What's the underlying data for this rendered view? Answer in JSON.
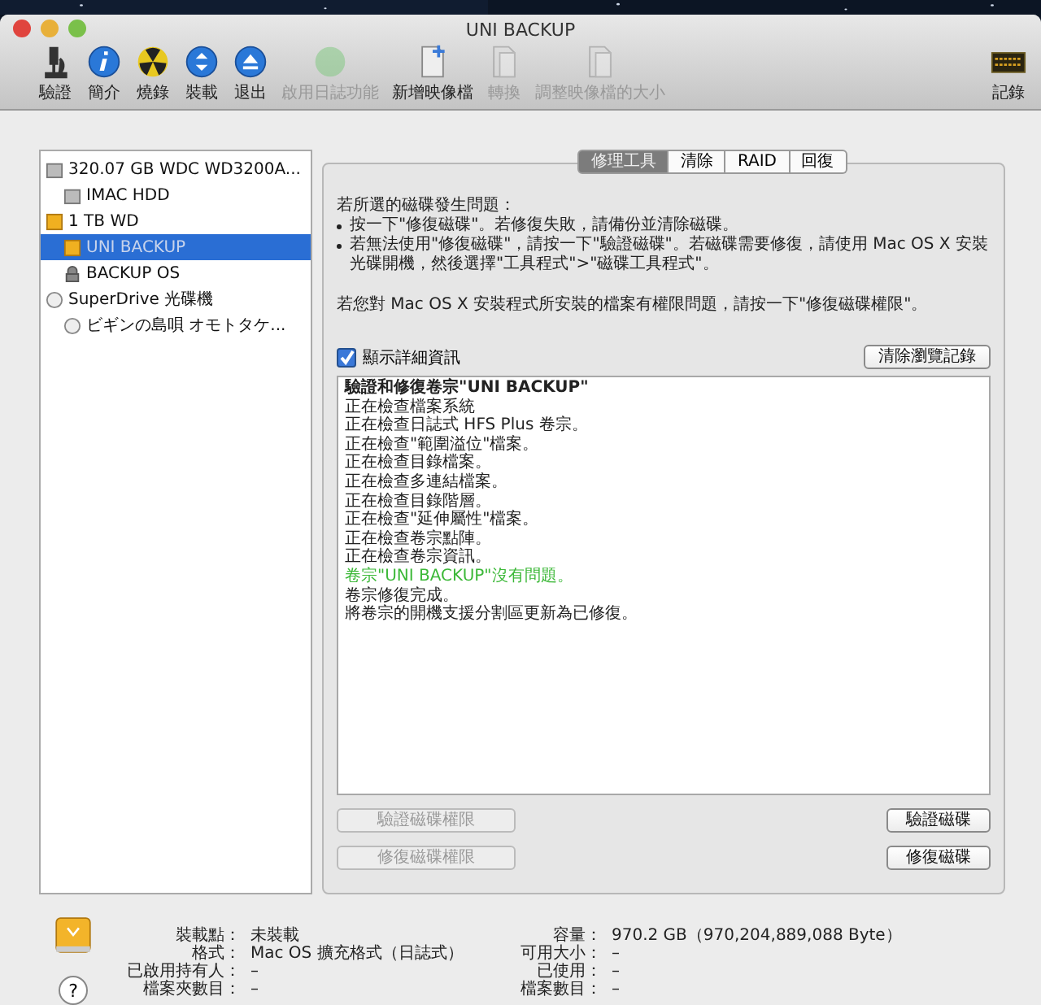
{
  "window": {
    "title": "UNI BACKUP"
  },
  "toolbar": [
    {
      "label": "驗證",
      "kind": "microscope",
      "disabled": false
    },
    {
      "label": "簡介",
      "kind": "info",
      "disabled": false
    },
    {
      "label": "燒錄",
      "kind": "burn",
      "disabled": false
    },
    {
      "label": "裝載",
      "kind": "mount",
      "disabled": false
    },
    {
      "label": "退出",
      "kind": "eject",
      "disabled": false
    },
    {
      "label": "啟用日誌功能",
      "kind": "journal",
      "disabled": true
    },
    {
      "label": "新增映像檔",
      "kind": "newimage",
      "disabled": false
    },
    {
      "label": "轉換",
      "kind": "convert",
      "disabled": true
    },
    {
      "label": "調整映像檔的大小",
      "kind": "resize",
      "disabled": true
    }
  ],
  "toolbar_right": {
    "label": "記錄",
    "kind": "log"
  },
  "sidebar": {
    "items": [
      {
        "label": "320.07 GB WDC WD3200A...",
        "kind": "hdd",
        "selected": false,
        "children": [
          {
            "label": "IMAC HDD",
            "kind": "hdd",
            "selected": false
          }
        ]
      },
      {
        "label": "1 TB WD",
        "kind": "external",
        "selected": false,
        "children": [
          {
            "label": "UNI BACKUP",
            "kind": "external",
            "selected": true
          },
          {
            "label": "BACKUP OS",
            "kind": "locked",
            "selected": false
          }
        ]
      },
      {
        "label": "SuperDrive 光碟機",
        "kind": "disc",
        "selected": false,
        "children": [
          {
            "label": "ビギンの島唄 オモトタケ...",
            "kind": "disc",
            "selected": false
          }
        ]
      }
    ]
  },
  "tabs": [
    {
      "label": "修理工具",
      "selected": true
    },
    {
      "label": "清除",
      "selected": false
    },
    {
      "label": "RAID",
      "selected": false
    },
    {
      "label": "回復",
      "selected": false
    }
  ],
  "instructions": {
    "intro": "若所選的磁碟發生問題：",
    "bullets": [
      "按一下\"修復磁碟\"。若修復失敗，請備份並清除磁碟。",
      "若無法使用\"修復磁碟\"，請按一下\"驗證磁碟\"。若磁碟需要修復，請使用 Mac OS X 安裝光碟開機，然後選擇\"工具程式\">\"磁碟工具程式\"。"
    ],
    "note": "若您對 Mac OS X 安裝程式所安裝的檔案有權限問題，請按一下\"修復磁碟權限\"。"
  },
  "details": {
    "label": "顯示詳細資訊",
    "checked": true
  },
  "clear_history_button": "清除瀏覽記錄",
  "log": [
    {
      "text": "驗證和修復卷宗\"UNI BACKUP\"",
      "kind": "heading"
    },
    {
      "text": "正在檢查檔案系統",
      "kind": "normal"
    },
    {
      "text": "正在檢查日誌式 HFS Plus 卷宗。",
      "kind": "normal"
    },
    {
      "text": "正在檢查\"範圍溢位\"檔案。",
      "kind": "normal"
    },
    {
      "text": "正在檢查目錄檔案。",
      "kind": "normal"
    },
    {
      "text": "正在檢查多連結檔案。",
      "kind": "normal"
    },
    {
      "text": "正在檢查目錄階層。",
      "kind": "normal"
    },
    {
      "text": "正在檢查\"延伸屬性\"檔案。",
      "kind": "normal"
    },
    {
      "text": "正在檢查卷宗點陣。",
      "kind": "normal"
    },
    {
      "text": "正在檢查卷宗資訊。",
      "kind": "normal"
    },
    {
      "text": "卷宗\"UNI BACKUP\"沒有問題。",
      "kind": "success"
    },
    {
      "text": "卷宗修復完成。",
      "kind": "normal"
    },
    {
      "text": "將卷宗的開機支援分割區更新為已修復。",
      "kind": "normal"
    }
  ],
  "actions": [
    {
      "label": "驗證磁碟權限",
      "disabled": true,
      "kind": "permission"
    },
    {
      "label": "驗證磁碟",
      "disabled": false,
      "kind": "disk"
    },
    {
      "label": "修復磁碟權限",
      "disabled": true,
      "kind": "permission"
    },
    {
      "label": "修復磁碟",
      "disabled": false,
      "kind": "disk"
    }
  ],
  "info": {
    "left": [
      {
        "label": "裝載點：",
        "value": "未裝載"
      },
      {
        "label": "格式：",
        "value": "Mac OS 擴充格式（日誌式）"
      },
      {
        "label": "已啟用持有人：",
        "value": "–"
      },
      {
        "label": "檔案夾數目：",
        "value": "–"
      }
    ],
    "right": [
      {
        "label": "容量：",
        "value": "970.2 GB（970,204,889,088 Byte）"
      },
      {
        "label": "可用大小：",
        "value": "–"
      },
      {
        "label": "已使用：",
        "value": "–"
      },
      {
        "label": "檔案數目：",
        "value": "–"
      }
    ]
  },
  "help_button": "?"
}
